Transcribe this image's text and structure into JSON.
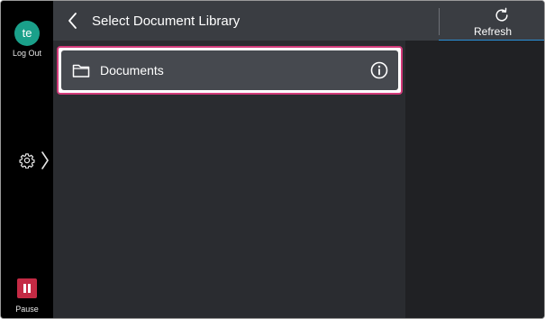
{
  "user": {
    "initials": "te",
    "logout_label": "Log Out"
  },
  "sidebar": {
    "pause_label": "Pause"
  },
  "header": {
    "title": "Select Document Library",
    "refresh_label": "Refresh"
  },
  "library": {
    "items": [
      {
        "label": "Documents"
      }
    ]
  },
  "colors": {
    "accent": "#2a8fd6",
    "selection": "#d23b7a",
    "avatar": "#1aa08a",
    "pause": "#c42a44"
  },
  "icons": [
    "back-arrow-icon",
    "refresh-icon",
    "folder-icon",
    "info-icon",
    "gear-icon",
    "chevron-right-icon",
    "pause-icon"
  ]
}
